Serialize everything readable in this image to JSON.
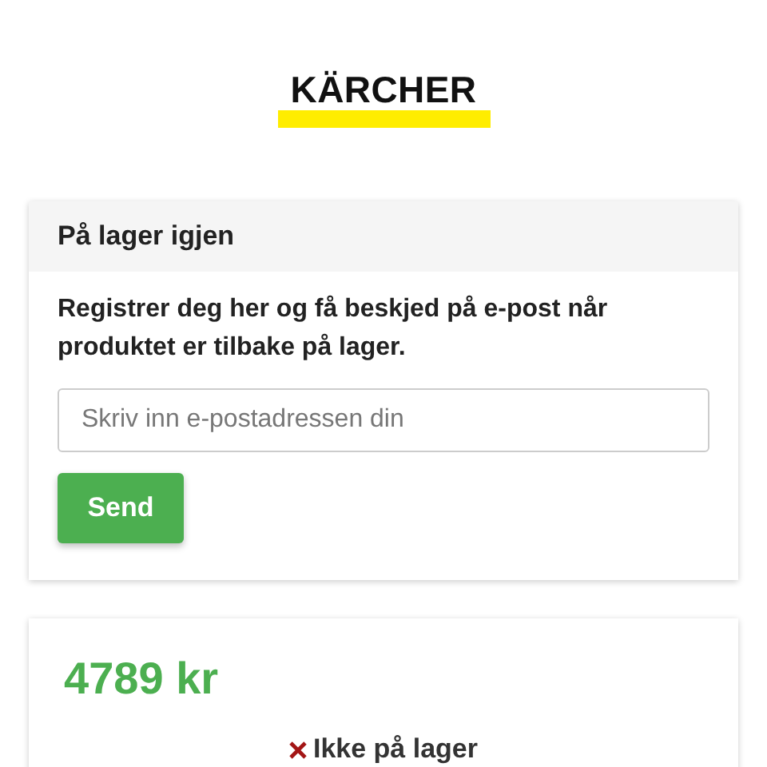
{
  "logo": {
    "text": "KÄRCHER"
  },
  "restock_card": {
    "title": "På lager igjen",
    "description": "Registrer deg her og få beskjed på e-post når produktet er tilbake på lager.",
    "email_field": {
      "placeholder": "Skriv inn e-postadressen din"
    },
    "button": "Send"
  },
  "price_card": {
    "price": "4789 kr",
    "stock_status": "Ikke på lager"
  }
}
